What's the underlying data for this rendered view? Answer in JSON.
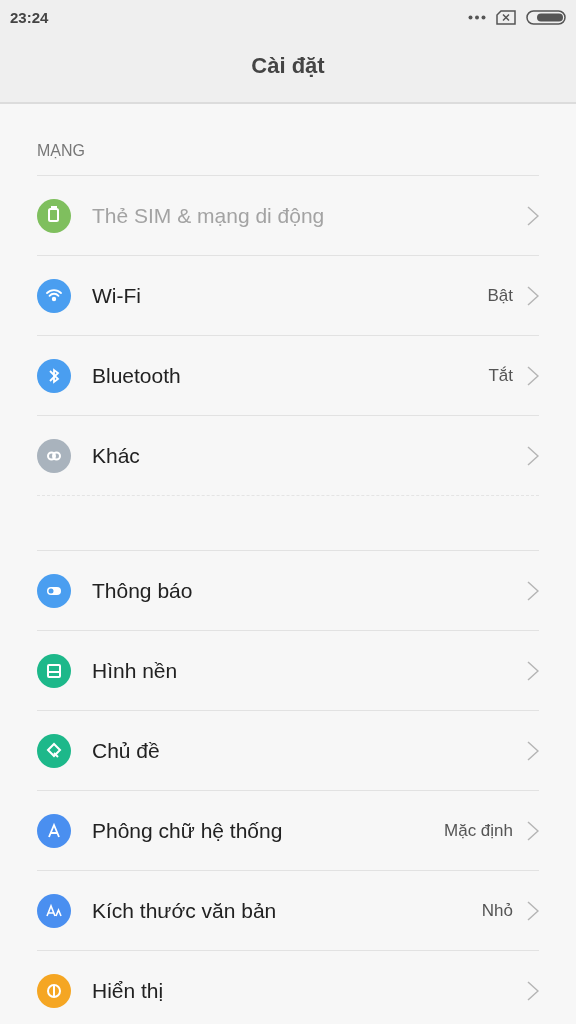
{
  "status_bar": {
    "time": "23:24"
  },
  "header": {
    "title": "Cài đặt"
  },
  "groups": [
    {
      "title": "MẠNG",
      "items": [
        {
          "label": "Thẻ SIM & mạng di động",
          "disabled": true,
          "color": "#7fbf5e"
        },
        {
          "label": "Wi-Fi",
          "value": "Bật",
          "disabled": false,
          "color": "#4a9ef0"
        },
        {
          "label": "Bluetooth",
          "value": "Tắt",
          "disabled": false,
          "color": "#4a9ef0"
        },
        {
          "label": "Khác",
          "disabled": false,
          "color": "#a9b3bd"
        }
      ]
    },
    {
      "items": [
        {
          "label": "Thông báo",
          "disabled": false,
          "color": "#4a9ef0"
        },
        {
          "label": "Hình nền",
          "disabled": false,
          "color": "#1db88a"
        },
        {
          "label": "Chủ đề",
          "disabled": false,
          "color": "#1db88a"
        },
        {
          "label": "Phông chữ hệ thống",
          "value": "Mặc định",
          "disabled": false,
          "color": "#4a8ff0"
        },
        {
          "label": "Kích thước văn bản",
          "value": "Nhỏ",
          "disabled": false,
          "color": "#4a8ff0"
        },
        {
          "label": "Hiển thị",
          "disabled": false,
          "color": "#f5a623"
        }
      ]
    }
  ]
}
